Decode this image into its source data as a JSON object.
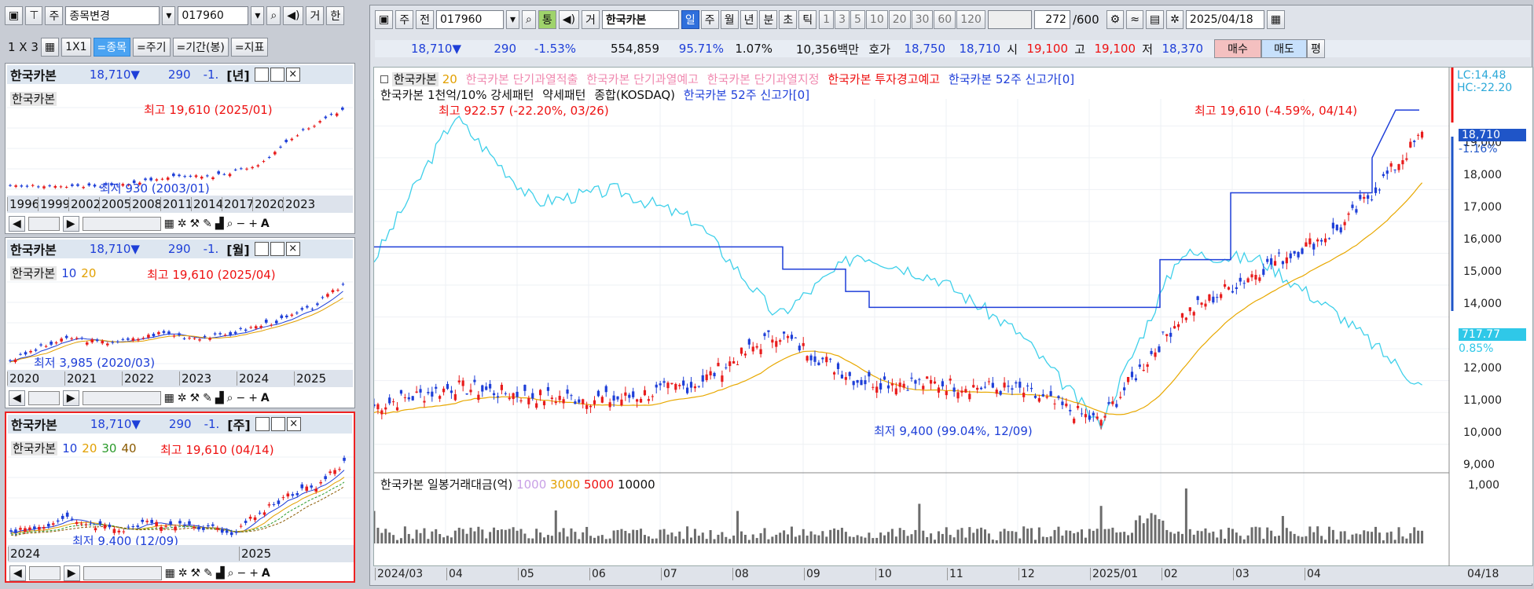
{
  "left": {
    "toolbar": {
      "type": "주",
      "action": "종목변경",
      "code": "017960",
      "mode": "거",
      "trade": "한"
    },
    "toolbar2": {
      "layout": "1 X 3",
      "grid": "1X1",
      "stock": "=종목",
      "period": "=주기",
      "range": "=기간(봉)",
      "indicator": "=지표"
    },
    "panels": [
      {
        "name": "한국카본",
        "price": "18,710▼",
        "chg": "290",
        "pct": "-1.",
        "period": "[년]",
        "tag": "한국카본",
        "ma": [],
        "hi": "최고 19,610 (2025/01)",
        "lo": "최저 930 (2003/01)",
        "axis": [
          "1996",
          "1999",
          "2002",
          "2005",
          "2008",
          "2011",
          "2014",
          "2017",
          "2020",
          "2023"
        ]
      },
      {
        "name": "한국카본",
        "price": "18,710▼",
        "chg": "290",
        "pct": "-1.",
        "period": "[월]",
        "tag": "한국카본",
        "ma": [
          "10",
          "20"
        ],
        "hi": "최고 19,610 (2025/04)",
        "lo": "최저 3,985 (2020/03)",
        "axis": [
          "2020",
          "2021",
          "2022",
          "2023",
          "2024",
          "2025"
        ]
      },
      {
        "name": "한국카본",
        "price": "18,710▼",
        "chg": "290",
        "pct": "-1.",
        "period": "[주]",
        "tag": "한국카본",
        "ma": [
          "10",
          "20",
          "30",
          "40"
        ],
        "hi": "최고 19,610 (04/14)",
        "lo": "최저 9,400 (12/09)",
        "axis": [
          "2024",
          "2025"
        ]
      }
    ]
  },
  "main": {
    "toolbar": {
      "type": "주",
      "prev": "전",
      "code": "017960",
      "tong": "통",
      "mode": "거",
      "name": "한국카본",
      "periods": [
        "일",
        "주",
        "월",
        "년",
        "분",
        "초",
        "틱"
      ],
      "nums": [
        "1",
        "3",
        "5",
        "10",
        "20",
        "30",
        "60",
        "120"
      ],
      "count": "272",
      "total": "/600",
      "date": "2025/04/18"
    },
    "quote": {
      "price": "18,710▼",
      "chg": "290",
      "pct": "-1.53%",
      "vol": "554,859",
      "ratio": "95.71%",
      "turn": "1.07%",
      "amt": "10,356백만",
      "ask_label": "호가",
      "ask1": "18,750",
      "ask2": "18,710",
      "open_label": "시",
      "open": "19,100",
      "high_label": "고",
      "high": "19,100",
      "low_label": "저",
      "low": "18,370",
      "buy": "매수",
      "sell": "매도",
      "avg": "평"
    },
    "legend1": [
      "한국카본",
      "20",
      "한국카본 단기과열적출",
      "한국카본 단기과열예고",
      "한국카본 단기과열지정",
      "한국카본 투자경고예고",
      "한국카본 52주 신고가[0]"
    ],
    "legend2": [
      "한국카본 1천억/10% 강세패턴",
      "약세패턴",
      "종합(KOSDAQ)",
      "한국카본 52주 신고가[0]"
    ],
    "ann": {
      "hi": "최고 19,610 (-4.59%, 04/14)",
      "lo": "최저 9,400 (99.04%, 12/09)",
      "idx": "최고 922.57 (-22.20%, 03/26)"
    },
    "yaxis": [
      "19,000",
      "18,000",
      "17,000",
      "16,000",
      "15,000",
      "14,000",
      "13,000",
      "12,000",
      "11,000",
      "10,000",
      "9,000"
    ],
    "lc": "LC:14.48",
    "hc": "HC:-22.20",
    "last_price": "18,710",
    "last_pct": "-1.16%",
    "kosdaq": "717.77",
    "kosdaq_pct": "0.85%",
    "vol_legend": [
      "한국카본 일봉거래대금(억)",
      "1000",
      "3000",
      "5000",
      "10000"
    ],
    "vol_axis": "1,000",
    "xaxis": [
      "2024/03",
      "04",
      "05",
      "06",
      "07",
      "08",
      "09",
      "10",
      "11",
      "12",
      "2025/01",
      "02",
      "03",
      "04"
    ],
    "xend": "04/18"
  },
  "chart_data": {
    "type": "line",
    "title": "",
    "x": [
      "2024/03",
      "2024/04",
      "2024/05",
      "2024/06",
      "2024/07",
      "2024/08",
      "2024/09",
      "2024/10",
      "2024/11",
      "2024/12",
      "2025/01",
      "2025/02",
      "2025/03",
      "2025/04"
    ],
    "series": [
      {
        "name": "한국카본",
        "values": [
          10200,
          10800,
          10500,
          10400,
          10900,
          12500,
          11000,
          10900,
          10700,
          9700,
          13000,
          14500,
          15800,
          18710
        ]
      }
    ],
    "ylim": [
      8500,
      19600
    ]
  }
}
